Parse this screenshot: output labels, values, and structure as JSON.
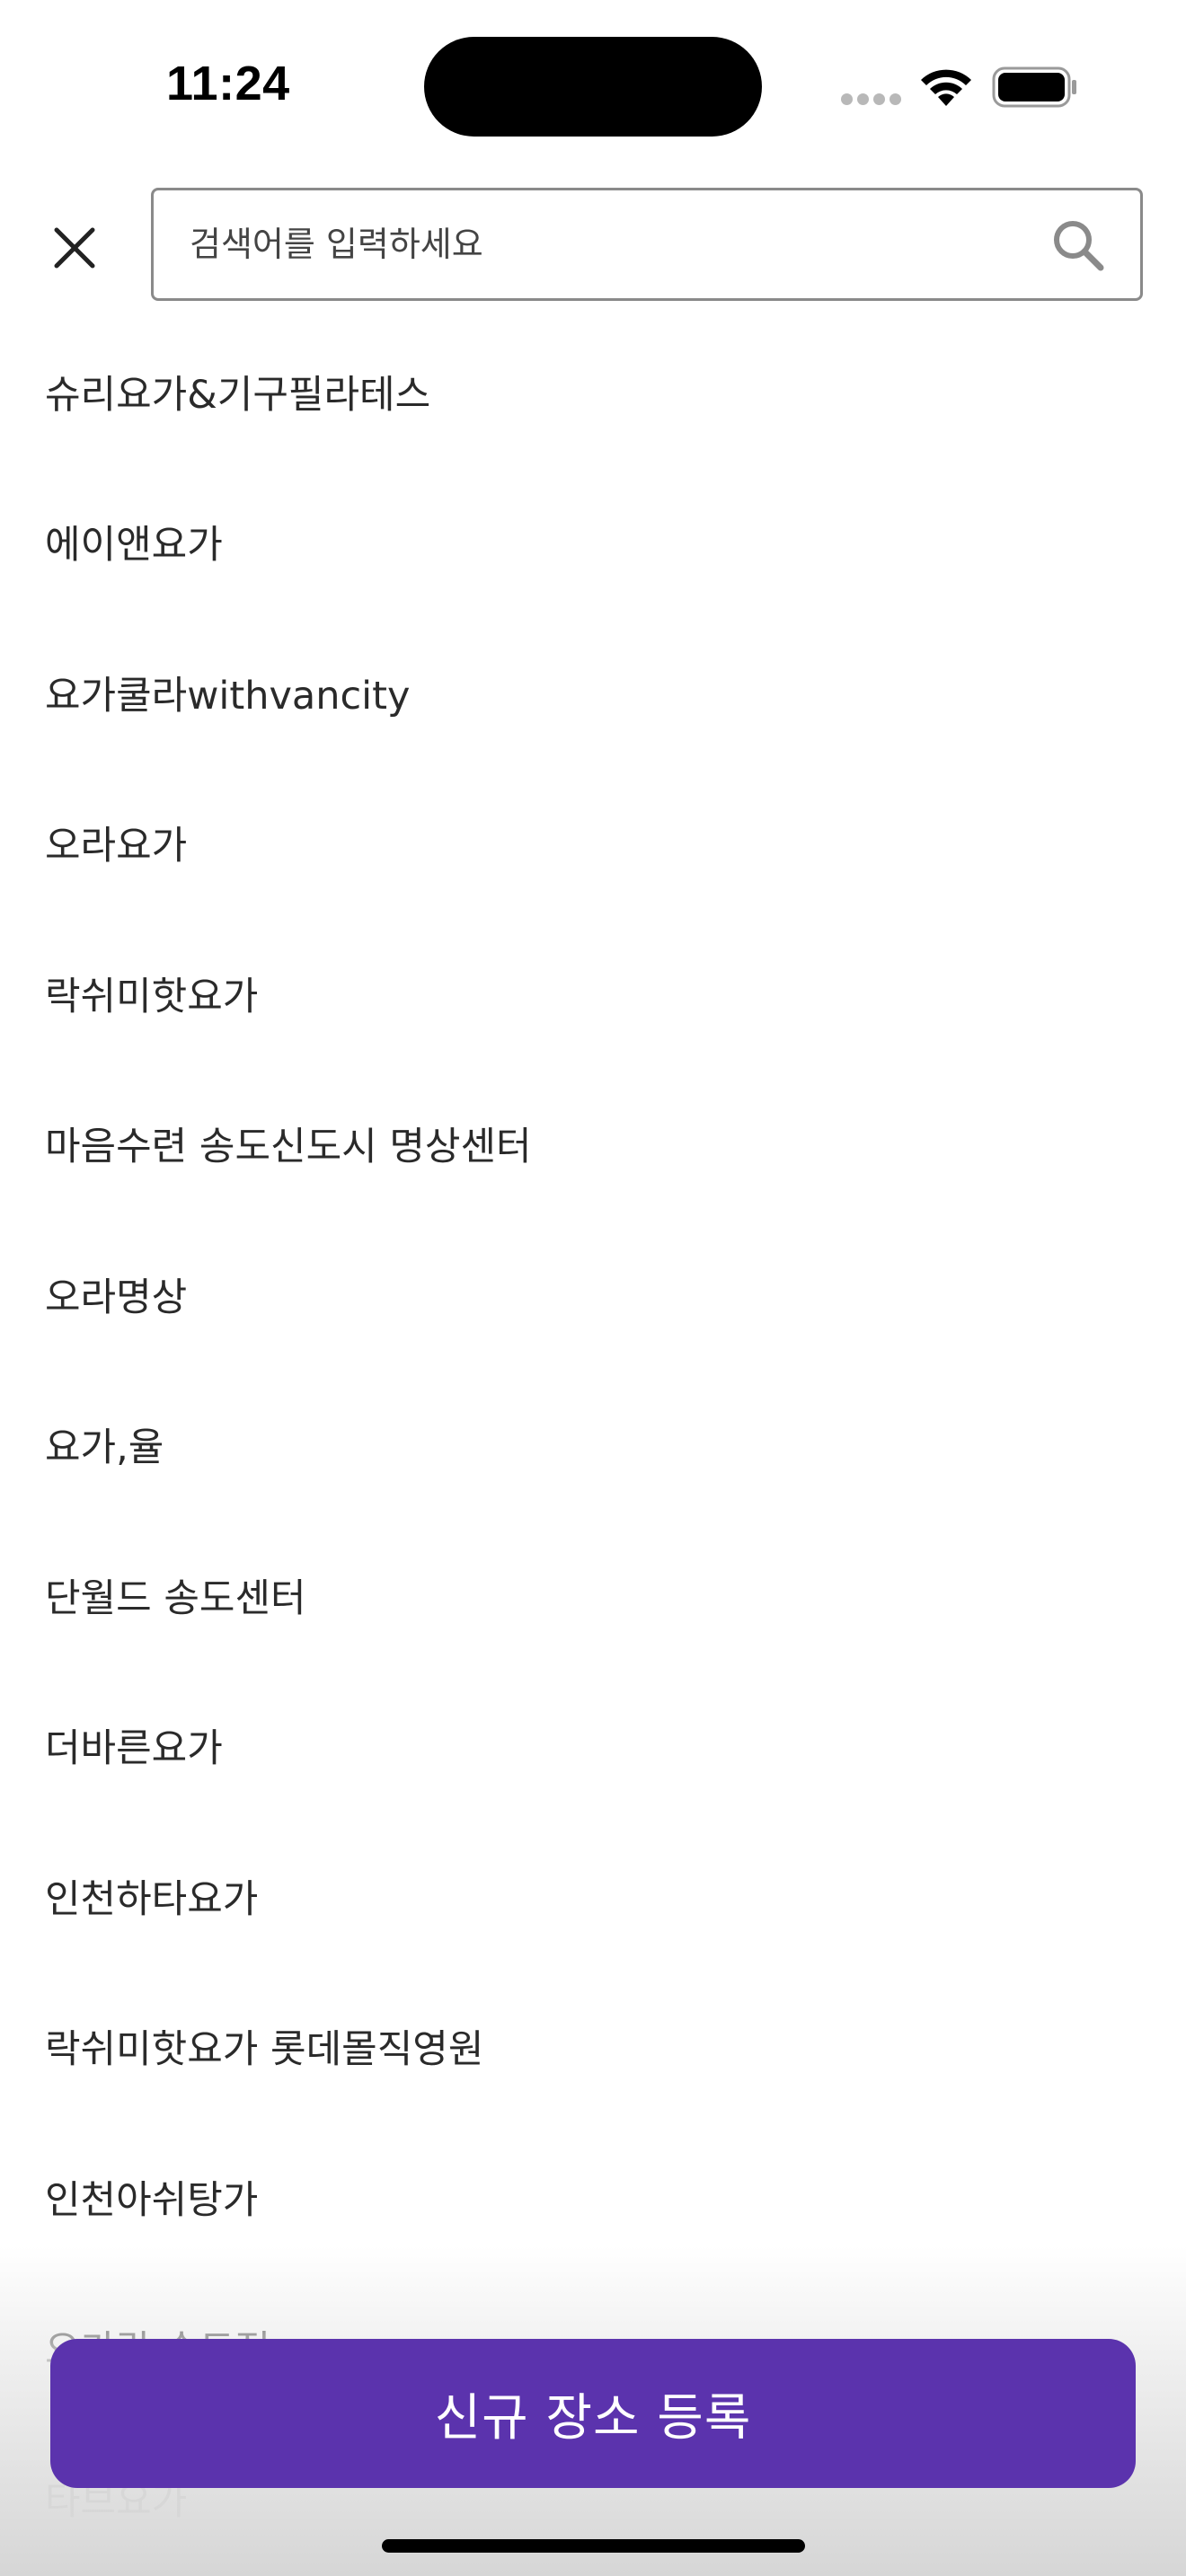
{
  "status_bar": {
    "time": "11:24"
  },
  "search": {
    "placeholder": "검색어를 입력하세요",
    "value": ""
  },
  "results": [
    "슈리요가&기구필라테스",
    "에이앤요가",
    "요가쿨라withvancity",
    "오라요가",
    "락쉬미핫요가",
    "마음수련 송도신도시 명상센터",
    "오라명상",
    "요가,율",
    "단월드 송도센터",
    "더바른요가",
    "인천하타요가",
    "락쉬미핫요가 롯데몰직영원",
    "인천아쉬탕가",
    "요가랑 송도점",
    "타브요가"
  ],
  "actions": {
    "register_label": "신규 장소 등록"
  },
  "colors": {
    "primary": "#5b33ad",
    "text": "#2a2a2a",
    "border": "#8a8a8a"
  },
  "icons": {
    "close": "close-icon",
    "search": "search-icon",
    "wifi": "wifi-icon",
    "battery": "battery-icon",
    "signal": "signal-icon"
  }
}
